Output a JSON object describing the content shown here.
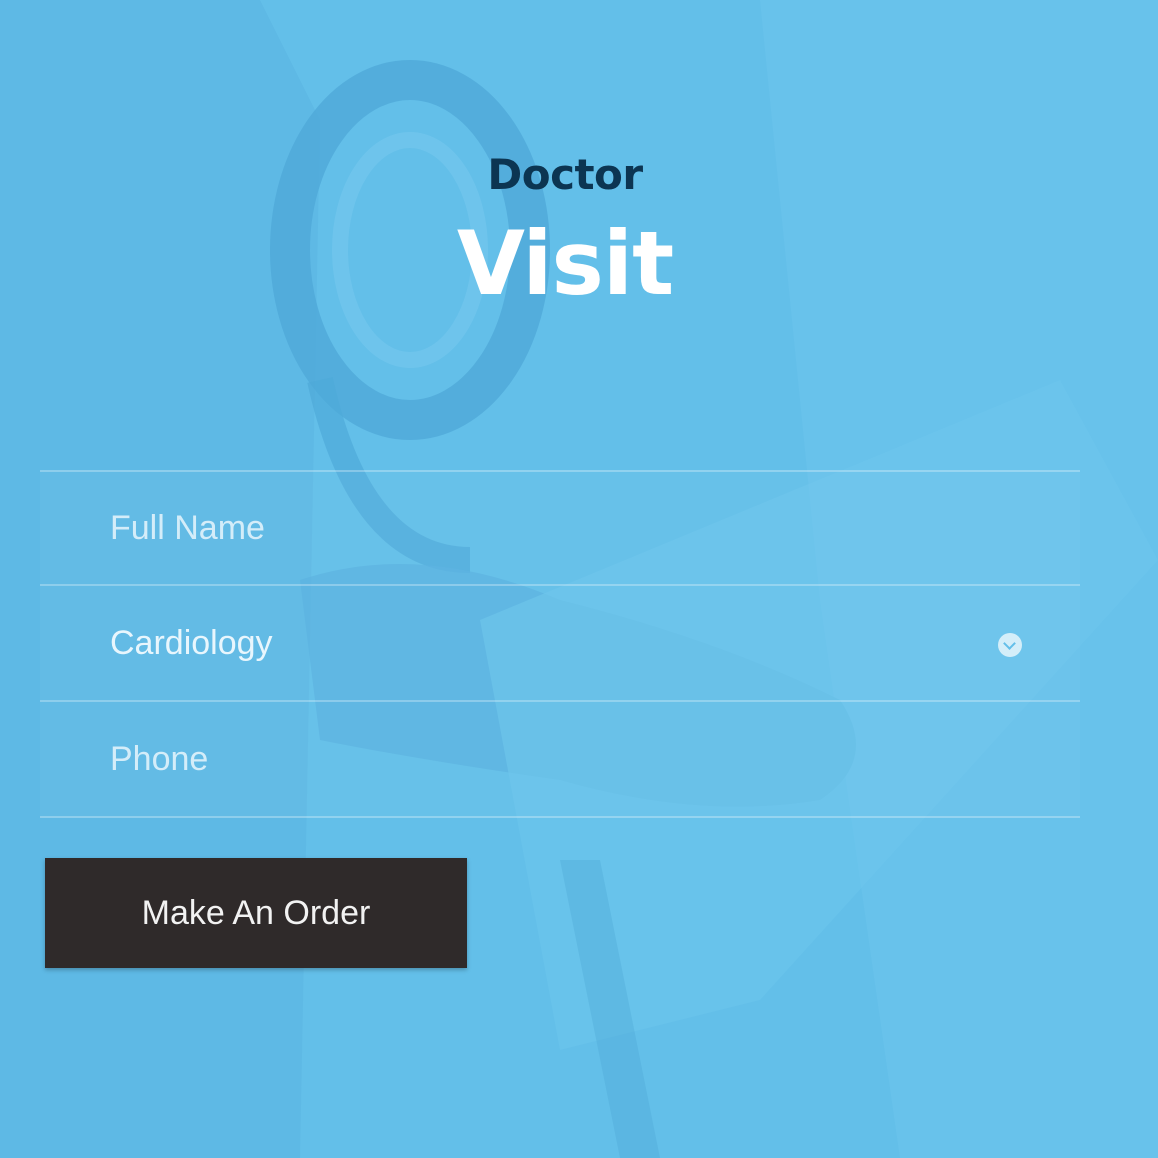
{
  "colors": {
    "background": "#63bfe9",
    "heading_dark": "#0c3552",
    "heading_light": "#ffffff",
    "button_bg": "#2f2a2a",
    "button_text": "#f2f2f2"
  },
  "heading": {
    "small": "Doctor",
    "big": "Visit"
  },
  "form": {
    "full_name_placeholder": "Full Name",
    "department_value": "Cardiology",
    "phone_placeholder": "Phone",
    "submit_label": "Make An Order"
  },
  "icons": {
    "department_select": "chevron-down-icon"
  }
}
